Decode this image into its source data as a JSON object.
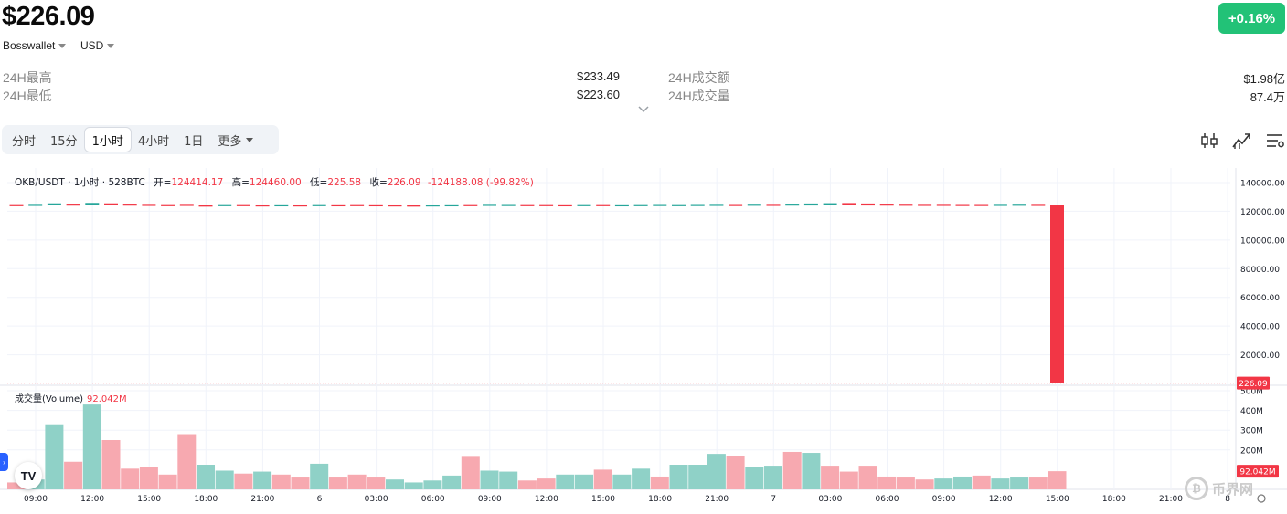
{
  "header": {
    "price": "$226.09",
    "change": "+0.16%",
    "exchange": "Bosswallet",
    "currency": "USD"
  },
  "stats": {
    "high_label": "24H最高",
    "high_value": "$233.49",
    "low_label": "24H最低",
    "low_value": "$223.60",
    "turnover_label": "24H成交额",
    "turnover_value": "$1.98亿",
    "volume_label": "24H成交量",
    "volume_value": "87.4万"
  },
  "tabs": [
    "分时",
    "15分",
    "1小时",
    "4小时",
    "1日",
    "更多"
  ],
  "active_tab": "1小时",
  "toolbar_icons": [
    "candlestick-indicator-icon",
    "trend-line-icon",
    "settings-list-icon"
  ],
  "colors": {
    "up": "#26a69a",
    "down": "#f23645",
    "vol_up": "#8fd1c7",
    "vol_down": "#f7a9b0",
    "badge": "#22c277"
  },
  "legend": {
    "symbol": "OKB/USDT · 1小时 · 528BTC",
    "open_label": "开",
    "open": "124414.17",
    "high_label": "高",
    "high": "124460.00",
    "low_label": "低",
    "low": "225.58",
    "close_label": "收",
    "close": "226.09",
    "change": "-124188.08 (-99.82%)"
  },
  "volume_legend": {
    "label": "成交量(Volume)",
    "value": "92.042M"
  },
  "watermark": "币界网",
  "chart_data": {
    "type": "candlestick",
    "price_axis": {
      "ticks": [
        "140000.00",
        "120000.00",
        "100000.00",
        "80000.00",
        "60000.00",
        "40000.00",
        "20000.00"
      ],
      "tick_values": [
        140000,
        120000,
        100000,
        80000,
        60000,
        40000,
        20000
      ],
      "ylim": [
        0,
        140000
      ],
      "last_price_label": "226.09",
      "last_price": 226.09
    },
    "volume_axis": {
      "ticks": [
        "500M",
        "400M",
        "300M",
        "200M"
      ],
      "tick_values": [
        500,
        400,
        300,
        200
      ],
      "ylim": [
        0,
        500
      ],
      "last_volume_label": "92.042M",
      "last_volume": 92.042
    },
    "x_ticks": [
      "09:00",
      "12:00",
      "15:00",
      "18:00",
      "21:00",
      "6",
      "03:00",
      "06:00",
      "09:00",
      "12:00",
      "15:00",
      "18:00",
      "21:00",
      "7",
      "03:00",
      "06:00",
      "09:00",
      "12:00",
      "15:00",
      "18:00",
      "21:00",
      "8"
    ],
    "candles": [
      {
        "c": 124300,
        "up": false
      },
      {
        "c": 124500,
        "up": true
      },
      {
        "c": 124900,
        "up": true
      },
      {
        "c": 124700,
        "up": false
      },
      {
        "c": 125200,
        "up": true
      },
      {
        "c": 124900,
        "up": false
      },
      {
        "c": 124700,
        "up": false
      },
      {
        "c": 124500,
        "up": false
      },
      {
        "c": 124300,
        "up": false
      },
      {
        "c": 124500,
        "up": false
      },
      {
        "c": 124000,
        "up": false
      },
      {
        "c": 124300,
        "up": true
      },
      {
        "c": 124300,
        "up": false
      },
      {
        "c": 124100,
        "up": false
      },
      {
        "c": 124200,
        "up": true
      },
      {
        "c": 124100,
        "up": false
      },
      {
        "c": 124300,
        "up": true
      },
      {
        "c": 124200,
        "up": false
      },
      {
        "c": 124300,
        "up": false
      },
      {
        "c": 124200,
        "up": false
      },
      {
        "c": 124100,
        "up": false
      },
      {
        "c": 124000,
        "up": false
      },
      {
        "c": 124100,
        "up": true
      },
      {
        "c": 124200,
        "up": true
      },
      {
        "c": 124300,
        "up": false
      },
      {
        "c": 124500,
        "up": true
      },
      {
        "c": 124400,
        "up": true
      },
      {
        "c": 124300,
        "up": false
      },
      {
        "c": 124300,
        "up": false
      },
      {
        "c": 124200,
        "up": false
      },
      {
        "c": 124300,
        "up": true
      },
      {
        "c": 124300,
        "up": false
      },
      {
        "c": 124200,
        "up": true
      },
      {
        "c": 124300,
        "up": true
      },
      {
        "c": 124400,
        "up": true
      },
      {
        "c": 124300,
        "up": true
      },
      {
        "c": 124400,
        "up": true
      },
      {
        "c": 124500,
        "up": true
      },
      {
        "c": 124400,
        "up": false
      },
      {
        "c": 124600,
        "up": true
      },
      {
        "c": 124500,
        "up": false
      },
      {
        "c": 124700,
        "up": true
      },
      {
        "c": 124800,
        "up": true
      },
      {
        "c": 125000,
        "up": true
      },
      {
        "c": 125100,
        "up": false
      },
      {
        "c": 124800,
        "up": false
      },
      {
        "c": 124700,
        "up": false
      },
      {
        "c": 124600,
        "up": false
      },
      {
        "c": 124500,
        "up": false
      },
      {
        "c": 124500,
        "up": false
      },
      {
        "c": 124400,
        "up": false
      },
      {
        "c": 124400,
        "up": false
      },
      {
        "c": 124500,
        "up": true
      },
      {
        "c": 124600,
        "up": true
      },
      {
        "c": 124500,
        "up": false
      },
      {
        "o": 124414.17,
        "h": 124460,
        "l": 225.58,
        "c": 226.09,
        "up": false
      }
    ],
    "volumes": [
      {
        "v": 35,
        "up": false
      },
      {
        "v": 50,
        "up": true
      },
      {
        "v": 330,
        "up": true
      },
      {
        "v": 140,
        "up": false
      },
      {
        "v": 430,
        "up": true
      },
      {
        "v": 250,
        "up": false
      },
      {
        "v": 105,
        "up": false
      },
      {
        "v": 115,
        "up": false
      },
      {
        "v": 75,
        "up": false
      },
      {
        "v": 280,
        "up": false
      },
      {
        "v": 125,
        "up": true
      },
      {
        "v": 95,
        "up": true
      },
      {
        "v": 80,
        "up": false
      },
      {
        "v": 90,
        "up": true
      },
      {
        "v": 75,
        "up": false
      },
      {
        "v": 60,
        "up": false
      },
      {
        "v": 130,
        "up": true
      },
      {
        "v": 60,
        "up": false
      },
      {
        "v": 75,
        "up": false
      },
      {
        "v": 60,
        "up": false
      },
      {
        "v": 50,
        "up": true
      },
      {
        "v": 35,
        "up": true
      },
      {
        "v": 45,
        "up": true
      },
      {
        "v": 70,
        "up": true
      },
      {
        "v": 165,
        "up": false
      },
      {
        "v": 95,
        "up": true
      },
      {
        "v": 90,
        "up": true
      },
      {
        "v": 45,
        "up": false
      },
      {
        "v": 55,
        "up": false
      },
      {
        "v": 75,
        "up": true
      },
      {
        "v": 75,
        "up": true
      },
      {
        "v": 100,
        "up": false
      },
      {
        "v": 75,
        "up": true
      },
      {
        "v": 105,
        "up": true
      },
      {
        "v": 65,
        "up": false
      },
      {
        "v": 125,
        "up": true
      },
      {
        "v": 125,
        "up": true
      },
      {
        "v": 180,
        "up": true
      },
      {
        "v": 170,
        "up": false
      },
      {
        "v": 115,
        "up": true
      },
      {
        "v": 120,
        "up": true
      },
      {
        "v": 190,
        "up": false
      },
      {
        "v": 185,
        "up": true
      },
      {
        "v": 120,
        "up": false
      },
      {
        "v": 90,
        "up": false
      },
      {
        "v": 120,
        "up": false
      },
      {
        "v": 65,
        "up": false
      },
      {
        "v": 60,
        "up": false
      },
      {
        "v": 50,
        "up": false
      },
      {
        "v": 55,
        "up": true
      },
      {
        "v": 65,
        "up": true
      },
      {
        "v": 70,
        "up": false
      },
      {
        "v": 55,
        "up": true
      },
      {
        "v": 60,
        "up": true
      },
      {
        "v": 60,
        "up": false
      },
      {
        "v": 92.042,
        "up": false
      }
    ]
  }
}
